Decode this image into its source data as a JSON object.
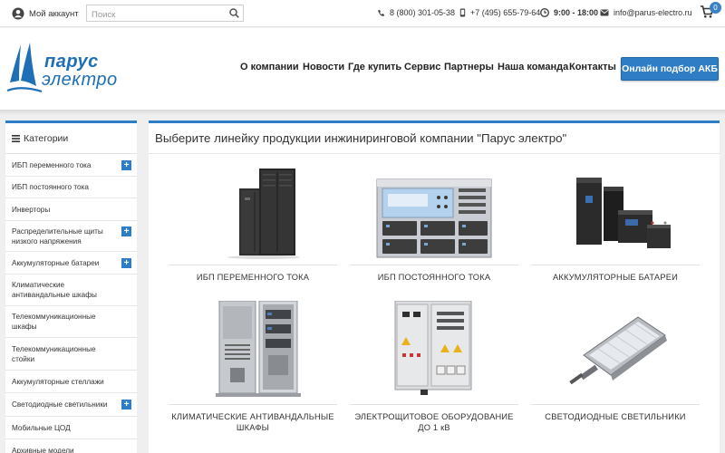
{
  "topbar": {
    "account_label": "Мой аккаунт",
    "search_placeholder": "Поиск",
    "phone1": "8 (800) 301-05-38",
    "phone2": "+7 (495) 655-79-64",
    "hours": "9:00 - 18:00",
    "email": "info@parus-electro.ru",
    "cart_count": "0"
  },
  "header": {
    "logo_line1": "парус",
    "logo_line2": "электро",
    "nav": [
      "О компании",
      "Новости",
      "Где купить",
      "Сервис",
      "Партнеры",
      "Наша команда",
      "Контакты"
    ],
    "cta_label": "Онлайн подбор АКБ"
  },
  "sidebar": {
    "title": "Категории",
    "items": [
      {
        "label": "ИБП переменного тока",
        "expandable": true
      },
      {
        "label": "ИБП постоянного тока",
        "expandable": false
      },
      {
        "label": "Инверторы",
        "expandable": false
      },
      {
        "label": "Распределительные щиты низкого напряжения",
        "expandable": true
      },
      {
        "label": "Аккумуляторные батареи",
        "expandable": true
      },
      {
        "label": "Климатические антивандальные шкафы",
        "expandable": false
      },
      {
        "label": "Телекоммуникационные шкафы",
        "expandable": false
      },
      {
        "label": "Телекоммуникационные стойки",
        "expandable": false
      },
      {
        "label": "Аккумуляторные стеллажи",
        "expandable": false
      },
      {
        "label": "Светодиодные светильники",
        "expandable": true
      },
      {
        "label": "Мобильные ЦОД",
        "expandable": false
      },
      {
        "label": "Архивные модели",
        "expandable": false
      }
    ]
  },
  "main": {
    "title": "Выберите линейку продукции инжиниринговой компании \"Парус электро\"",
    "products": [
      {
        "label": "ИБП ПЕРЕМЕННОГО ТОКА"
      },
      {
        "label": "ИБП ПОСТОЯННОГО ТОКА"
      },
      {
        "label": "АККУМУЛЯТОРНЫЕ БАТАРЕИ"
      },
      {
        "label": "КЛИМАТИЧЕСКИЕ АНТИВАНДАЛЬНЫЕ ШКАФЫ"
      },
      {
        "label": "ЭЛЕКТРОЩИТОВОЕ ОБОРУДОВАНИЕ ДО 1 кВ"
      },
      {
        "label": "СВЕТОДИОДНЫЕ СВЕТИЛЬНИКИ"
      }
    ]
  },
  "colors": {
    "accent": "#2d7ec6",
    "logo": "#1e6fb5"
  }
}
